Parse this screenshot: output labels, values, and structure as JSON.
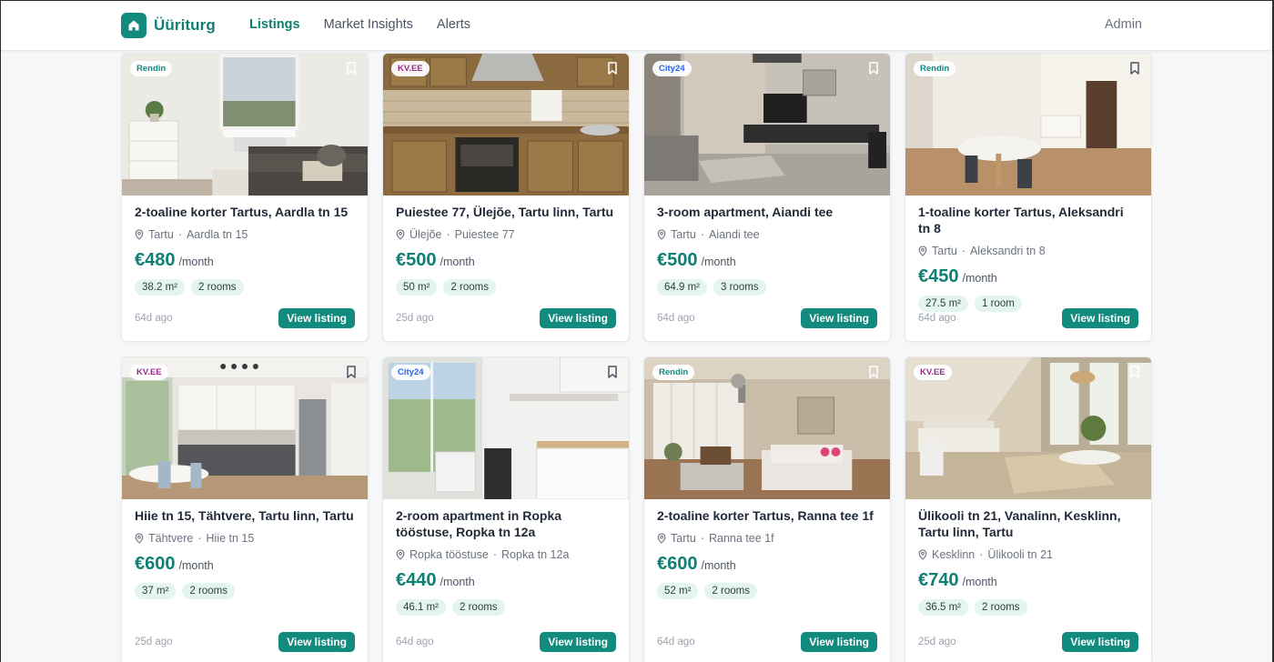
{
  "app": {
    "name": "Üüriturg",
    "accent": "#138a7e"
  },
  "nav": {
    "listings": "Listings",
    "insights": "Market Insights",
    "alerts": "Alerts",
    "admin": "Admin"
  },
  "listings": [
    {
      "source": "Rendin",
      "source_color": "#138a7e",
      "title": "2-toaline korter Tartus, Aardla tn 15",
      "district": "Tartu",
      "street": "Aardla tn 15",
      "price": "€480",
      "per": "/month",
      "area": "38.2 m²",
      "rooms": "2 rooms",
      "ago": "64d ago",
      "cta": "View listing"
    },
    {
      "source": "KV.EE",
      "source_color": "#9b2c8f",
      "title": "Puiestee 77, Ülejõe, Tartu linn, Tartu",
      "district": "Ülejõe",
      "street": "Puiestee 77",
      "price": "€500",
      "per": "/month",
      "area": "50 m²",
      "rooms": "2 rooms",
      "ago": "25d ago",
      "cta": "View listing"
    },
    {
      "source": "City24",
      "source_color": "#2563eb",
      "title": "3-room apartment, Aiandi tee",
      "district": "Tartu",
      "street": "Aiandi tee",
      "price": "€500",
      "per": "/month",
      "area": "64.9 m²",
      "rooms": "3 rooms",
      "ago": "64d ago",
      "cta": "View listing"
    },
    {
      "source": "Rendin",
      "source_color": "#138a7e",
      "title": "1-toaline korter Tartus, Aleksandri tn 8",
      "district": "Tartu",
      "street": "Aleksandri tn 8",
      "price": "€450",
      "per": "/month",
      "area": "27.5 m²",
      "rooms": "1 room",
      "ago": "64d ago",
      "cta": "View listing"
    },
    {
      "source": "KV.EE",
      "source_color": "#9b2c8f",
      "title": "Hiie tn 15, Tähtvere, Tartu linn, Tartu",
      "district": "Tähtvere",
      "street": "Hiie tn 15",
      "price": "€600",
      "per": "/month",
      "area": "37 m²",
      "rooms": "2 rooms",
      "ago": "25d ago",
      "cta": "View listing"
    },
    {
      "source": "City24",
      "source_color": "#2563eb",
      "title": "2-room apartment in Ropka tööstuse, Ropka tn 12a",
      "district": "Ropka tööstuse",
      "street": "Ropka tn 12a",
      "price": "€440",
      "per": "/month",
      "area": "46.1 m²",
      "rooms": "2 rooms",
      "ago": "64d ago",
      "cta": "View listing"
    },
    {
      "source": "Rendin",
      "source_color": "#138a7e",
      "title": "2-toaline korter Tartus, Ranna tee 1f",
      "district": "Tartu",
      "street": "Ranna tee 1f",
      "price": "€600",
      "per": "/month",
      "area": "52 m²",
      "rooms": "2 rooms",
      "ago": "64d ago",
      "cta": "View listing"
    },
    {
      "source": "KV.EE",
      "source_color": "#9b2c8f",
      "title": "Ülikooli tn 21, Vanalinn, Kesklinn, Tartu linn, Tartu",
      "district": "Kesklinn",
      "street": "Ülikooli tn 21",
      "price": "€740",
      "per": "/month",
      "area": "36.5 m²",
      "rooms": "2 rooms",
      "ago": "25d ago",
      "cta": "View listing"
    }
  ]
}
